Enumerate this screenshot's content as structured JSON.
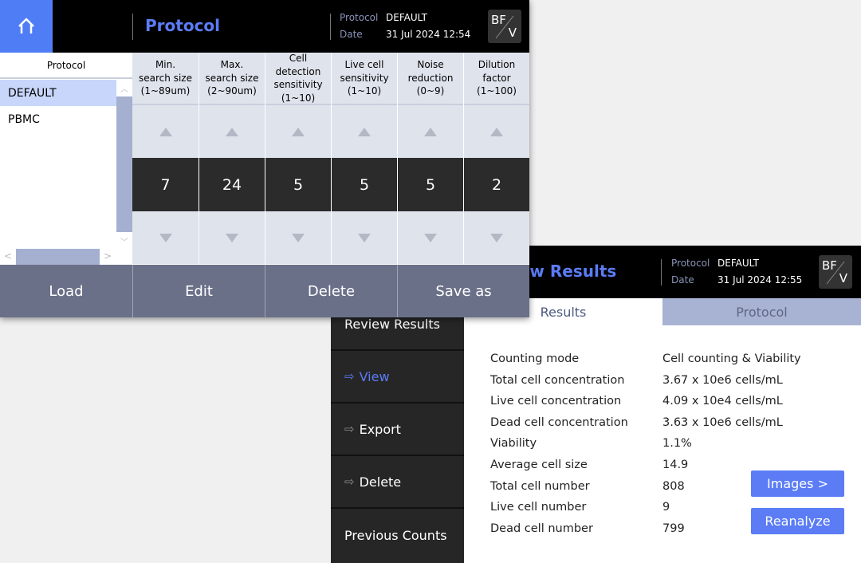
{
  "protocol_window": {
    "title": "Protocol",
    "meta": {
      "protocol_label": "Protocol",
      "protocol_value": "DEFAULT",
      "date_label": "Date",
      "date_value": "31 Jul 2024 12:54"
    },
    "mode_badge": {
      "top": "BF",
      "bottom": "V"
    },
    "list": {
      "header": "Protocol",
      "items": [
        "DEFAULT",
        "PBMC"
      ],
      "selected": "DEFAULT"
    },
    "columns": [
      {
        "header": "Min.\nsearch size\n(1~89um)",
        "value": "7"
      },
      {
        "header": "Max.\nsearch size\n(2~90um)",
        "value": "24"
      },
      {
        "header": "Cell\ndetection\nsensitivity\n(1~10)",
        "value": "5"
      },
      {
        "header": "Live cell\nsensitivity\n(1~10)",
        "value": "5"
      },
      {
        "header": "Noise\nreduction\n(0~9)",
        "value": "5"
      },
      {
        "header": "Dilution\nfactor\n(1~100)",
        "value": "2"
      }
    ],
    "buttons": [
      "Load",
      "Edit",
      "Delete",
      "Save as"
    ]
  },
  "results_window": {
    "title": "Review Results",
    "meta": {
      "protocol_label": "Protocol",
      "protocol_value": "DEFAULT",
      "date_label": "Date",
      "date_value": "31 Jul 2024 12:55"
    },
    "mode_badge": {
      "top": "BF",
      "bottom": "V"
    },
    "sidebar": {
      "header": "Review Results",
      "items": [
        {
          "label": "View",
          "active": true
        },
        {
          "label": "Export"
        },
        {
          "label": "Delete"
        }
      ],
      "footer": "Previous Counts"
    },
    "tabs": [
      {
        "label": "Results",
        "active": true
      },
      {
        "label": "Protocol"
      }
    ],
    "results": [
      {
        "label": "Counting mode",
        "value": "Cell counting & Viability"
      },
      {
        "label": "Total cell concentration",
        "value": "3.67 x 10e6 cells/mL"
      },
      {
        "label": "Live cell concentration",
        "value": "4.09 x 10e4 cells/mL"
      },
      {
        "label": "Dead cell concentration",
        "value": "3.63 x 10e6 cells/mL"
      },
      {
        "label": "Viability",
        "value": "1.1%"
      },
      {
        "label": "Average cell size",
        "value": "14.9"
      },
      {
        "label": "Total cell number",
        "value": "808"
      },
      {
        "label": "Live cell number",
        "value": "9"
      },
      {
        "label": "Dead cell number",
        "value": "799"
      }
    ],
    "buttons": {
      "images": "Images >",
      "reanalyze": "Reanalyze"
    }
  },
  "colors": {
    "accent": "#5b7cf5",
    "home": "#4f7df5",
    "button_bar": "#6b7089",
    "selected_row": "#c8d6fb"
  }
}
